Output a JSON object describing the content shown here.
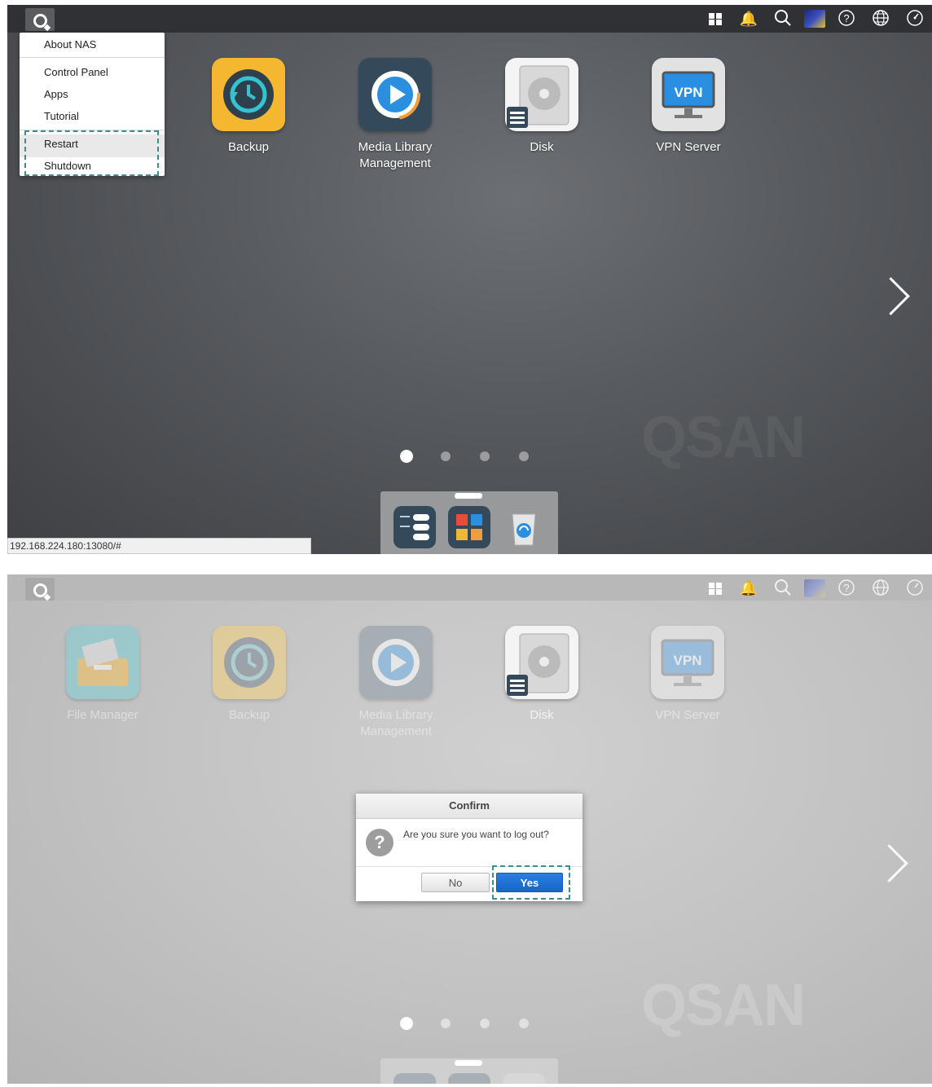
{
  "panel1": {
    "address_bar": "192.168.224.180:13080/#",
    "start_menu": {
      "items": [
        "About NAS",
        "Control Panel",
        "Apps",
        "Tutorial",
        "Restart",
        "Shutdown"
      ]
    },
    "apps": [
      "Backup",
      "Media Library\nManagement",
      "Disk",
      "VPN Server"
    ],
    "vpn_badge": "VPN",
    "watermark": "QSAN",
    "page_count": 4,
    "active_page": 1
  },
  "panel2": {
    "apps": [
      "File Manager",
      "Backup",
      "Media Library\nManagement",
      "Disk",
      "VPN Server"
    ],
    "vpn_badge": "VPN",
    "watermark": "QSAN",
    "dialog": {
      "title": "Confirm",
      "icon": "?",
      "message": "Are you sure you want to log out?",
      "no_label": "No",
      "yes_label": "Yes"
    },
    "page_count": 4,
    "active_page": 1
  },
  "toolbar_icons": [
    "apps-grid-icon",
    "bell-icon",
    "search-icon",
    "user-avatar-icon",
    "help-icon",
    "language-globe-icon",
    "dashboard-gauge-icon"
  ],
  "colors": {
    "highlight_dash": "#3e8f8c",
    "yes_button": "#1f72d6",
    "backup_tile": "#f6b730",
    "media_tile": "#34495a",
    "vpn_screen": "#2a8fe0"
  }
}
